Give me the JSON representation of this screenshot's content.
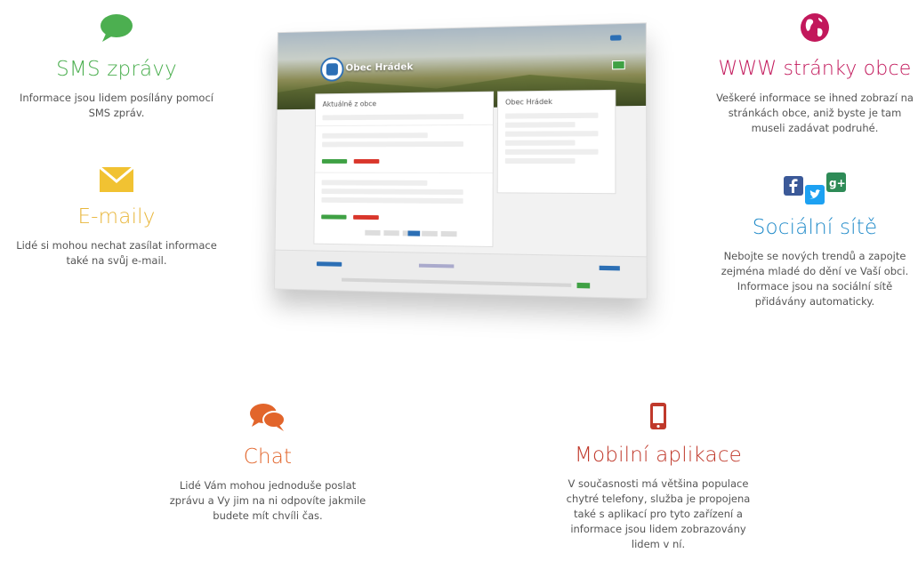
{
  "features": {
    "sms": {
      "title": "SMS zprávy",
      "desc_lines": [
        "Informace jsou lidem posílány pomocí",
        "SMS zpráv."
      ],
      "color": "#4caf50",
      "icon": "speech-bubble-icon"
    },
    "email": {
      "title": "E-maily",
      "desc_lines": [
        "Lidé si mohou nechat zasílat informace",
        "také na svůj e-mail."
      ],
      "color": "#e8b63a",
      "icon": "envelope-icon"
    },
    "www": {
      "title": "WWW stránky obce",
      "desc_lines": [
        "Veškeré informace se ihned zobrazí na",
        "stránkách obce, aniž byste je tam",
        "museli zadávat podruhé."
      ],
      "color": "#c2185b",
      "icon": "globe-icon"
    },
    "social": {
      "title": "Sociální sítě",
      "desc_lines": [
        "Nebojte se nových trendů a zapojte",
        "zejména mladé do dění ve Vaší obci.",
        "Informace jsou na sociální sítě",
        "přidávány automaticky."
      ],
      "color": "#1f8ac9",
      "icon": "social-networks-icon"
    },
    "chat": {
      "title": "Chat",
      "desc_lines": [
        "Lidé Vám mohou jednoduše poslat",
        "zprávu a Vy jim na ni odpovíte jakmile",
        "budete mít chvíli čas."
      ],
      "color": "#e2652b",
      "icon": "chat-bubbles-icon"
    },
    "mobile": {
      "title": "Mobilní aplikace",
      "desc_lines": [
        "V současnosti má většina populace",
        "chytré telefony, služba je propojena",
        "také s aplikací pro tyto zařízení a",
        "informace jsou lidem zobrazovány",
        "lidem v ní."
      ],
      "color": "#c0392b",
      "icon": "smartphone-icon"
    }
  },
  "mockup": {
    "brand": "Obec Hrádek",
    "left_heading": "Aktuálně z obce",
    "right_heading": "Obec Hrádek"
  }
}
